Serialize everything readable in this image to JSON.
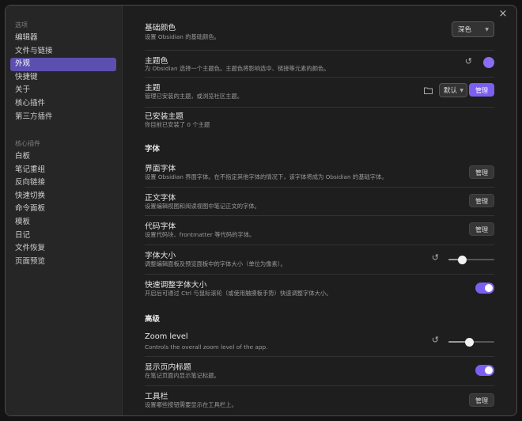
{
  "sidebar": {
    "options_title": "选项",
    "options": [
      {
        "label": "编辑器"
      },
      {
        "label": "文件与链接"
      },
      {
        "label": "外观",
        "active": true
      },
      {
        "label": "快捷键"
      },
      {
        "label": "关于"
      },
      {
        "label": "核心插件"
      },
      {
        "label": "第三方插件"
      }
    ],
    "core_title": "核心插件",
    "core": [
      {
        "label": "白板"
      },
      {
        "label": "笔记重组"
      },
      {
        "label": "反向链接"
      },
      {
        "label": "快速切换"
      },
      {
        "label": "命令面板"
      },
      {
        "label": "模板"
      },
      {
        "label": "日记"
      },
      {
        "label": "文件恢复"
      },
      {
        "label": "页面预览"
      }
    ]
  },
  "close_icon": "×",
  "settings": {
    "base_color": {
      "title": "基础颜色",
      "desc": "设置 Obsidian 的基础颜色。",
      "value": "深色"
    },
    "accent_color": {
      "title": "主题色",
      "desc": "为 Obsidian 选择一个主题色。主题色将影响选中、链接等元素的颜色。",
      "color": "#8b6cf5"
    },
    "theme": {
      "title": "主题",
      "desc": "管理已安装的主题，或浏览社区主题。",
      "value": "默认",
      "button": "管理"
    },
    "installed": {
      "title": "已安装主题",
      "desc": "你目前已安装了 0 个主题"
    },
    "font_section": "字体",
    "interface_font": {
      "title": "界面字体",
      "desc": "设置 Obsidian 界面字体。在不指定其他字体的情况下，该字体将成为 Obsidian 的基础字体。",
      "button": "管理"
    },
    "text_font": {
      "title": "正文字体",
      "desc": "设置编辑视图和阅读视图中笔记正文的字体。",
      "button": "管理"
    },
    "code_font": {
      "title": "代码字体",
      "desc": "设置代码块、frontmatter 等代码的字体。",
      "button": "管理"
    },
    "font_size": {
      "title": "字体大小",
      "desc": "调整编辑面板及预览面板中的字体大小（单位为像素）。",
      "level": 0.3
    },
    "quick_font": {
      "title": "快速调整字体大小",
      "desc": "开启后可通过 Ctrl 与鼠标滚轮（或使用触摸板手势）快速调整字体大小。",
      "on": true
    },
    "advanced_section": "高级",
    "zoom": {
      "title": "Zoom level",
      "desc": "Controls the overall zoom level of the app.",
      "level": 0.45
    },
    "inline_title": {
      "title": "显示页内标题",
      "desc": "在笔记页面内显示笔记标题。",
      "on": true
    },
    "toolbar": {
      "title": "工具栏",
      "desc": "设置哪些按钮需要显示在工具栏上。",
      "button": "管理"
    }
  }
}
